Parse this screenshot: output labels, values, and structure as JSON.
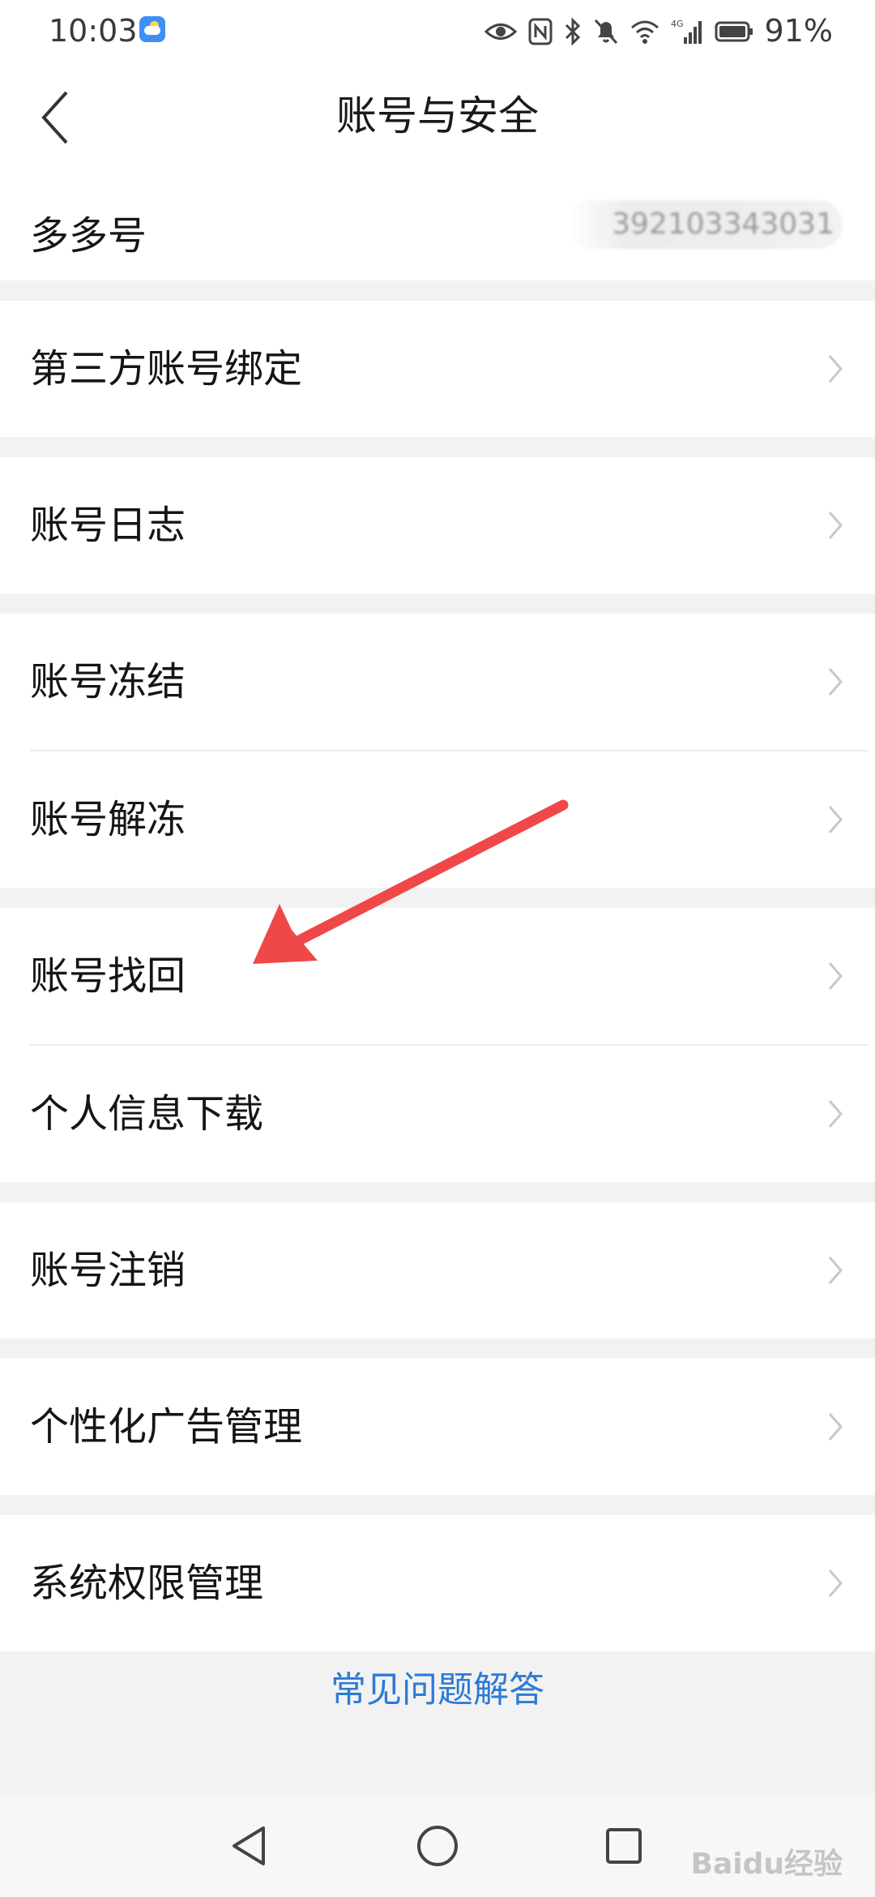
{
  "status_bar": {
    "time": "10:03",
    "battery": "91%",
    "network": "4G",
    "icons": [
      "weather-icon",
      "eye-icon",
      "nfc-icon",
      "bluetooth-icon",
      "mute-icon",
      "wifi-icon",
      "signal-icon",
      "battery-icon"
    ]
  },
  "header": {
    "title": "账号与安全",
    "back_icon": "chevron-left-icon"
  },
  "list": {
    "duoduo_id": {
      "label": "多多号",
      "value": "392103343031"
    },
    "third_party": {
      "label": "第三方账号绑定"
    },
    "account_log": {
      "label": "账号日志"
    },
    "freeze": {
      "label": "账号冻结"
    },
    "unfreeze": {
      "label": "账号解冻"
    },
    "recover": {
      "label": "账号找回"
    },
    "download": {
      "label": "个人信息下载"
    },
    "cancel": {
      "label": "账号注销"
    },
    "ads": {
      "label": "个性化广告管理"
    },
    "permissions": {
      "label": "系统权限管理"
    }
  },
  "faq": {
    "label": "常见问题解答"
  },
  "annotation": {
    "color": "#f04848",
    "target": "账号找回"
  },
  "watermark": {
    "text": "Baidu经验"
  },
  "colors": {
    "background": "#f2f2f2",
    "row_background": "#ffffff",
    "link": "#2d7ad6",
    "chevron": "#c8c8c8"
  }
}
